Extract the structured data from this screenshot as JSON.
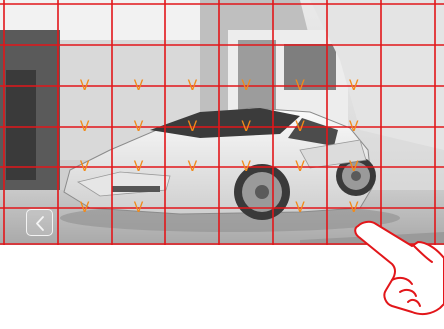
{
  "screen": {
    "photo_subject": "white sports car in front of modern white building",
    "grid": {
      "cols": 8,
      "rows": 6,
      "color": "#e2161a"
    },
    "marks": {
      "glyph": "V",
      "color": "#f28a1a",
      "cells": [
        [
          2,
          1
        ],
        [
          2,
          2
        ],
        [
          2,
          3
        ],
        [
          2,
          4
        ],
        [
          2,
          5
        ],
        [
          2,
          6
        ],
        [
          3,
          1
        ],
        [
          3,
          2
        ],
        [
          3,
          3
        ],
        [
          3,
          4
        ],
        [
          3,
          5
        ],
        [
          3,
          6
        ],
        [
          4,
          1
        ],
        [
          4,
          2
        ],
        [
          4,
          3
        ],
        [
          4,
          4
        ],
        [
          4,
          5
        ],
        [
          4,
          6
        ],
        [
          5,
          1
        ],
        [
          5,
          2
        ],
        [
          5,
          5
        ],
        [
          5,
          6
        ]
      ]
    },
    "back_button": {
      "icon": "chevron-left-icon"
    }
  },
  "gesture": {
    "icon": "pointing-hand-icon"
  }
}
